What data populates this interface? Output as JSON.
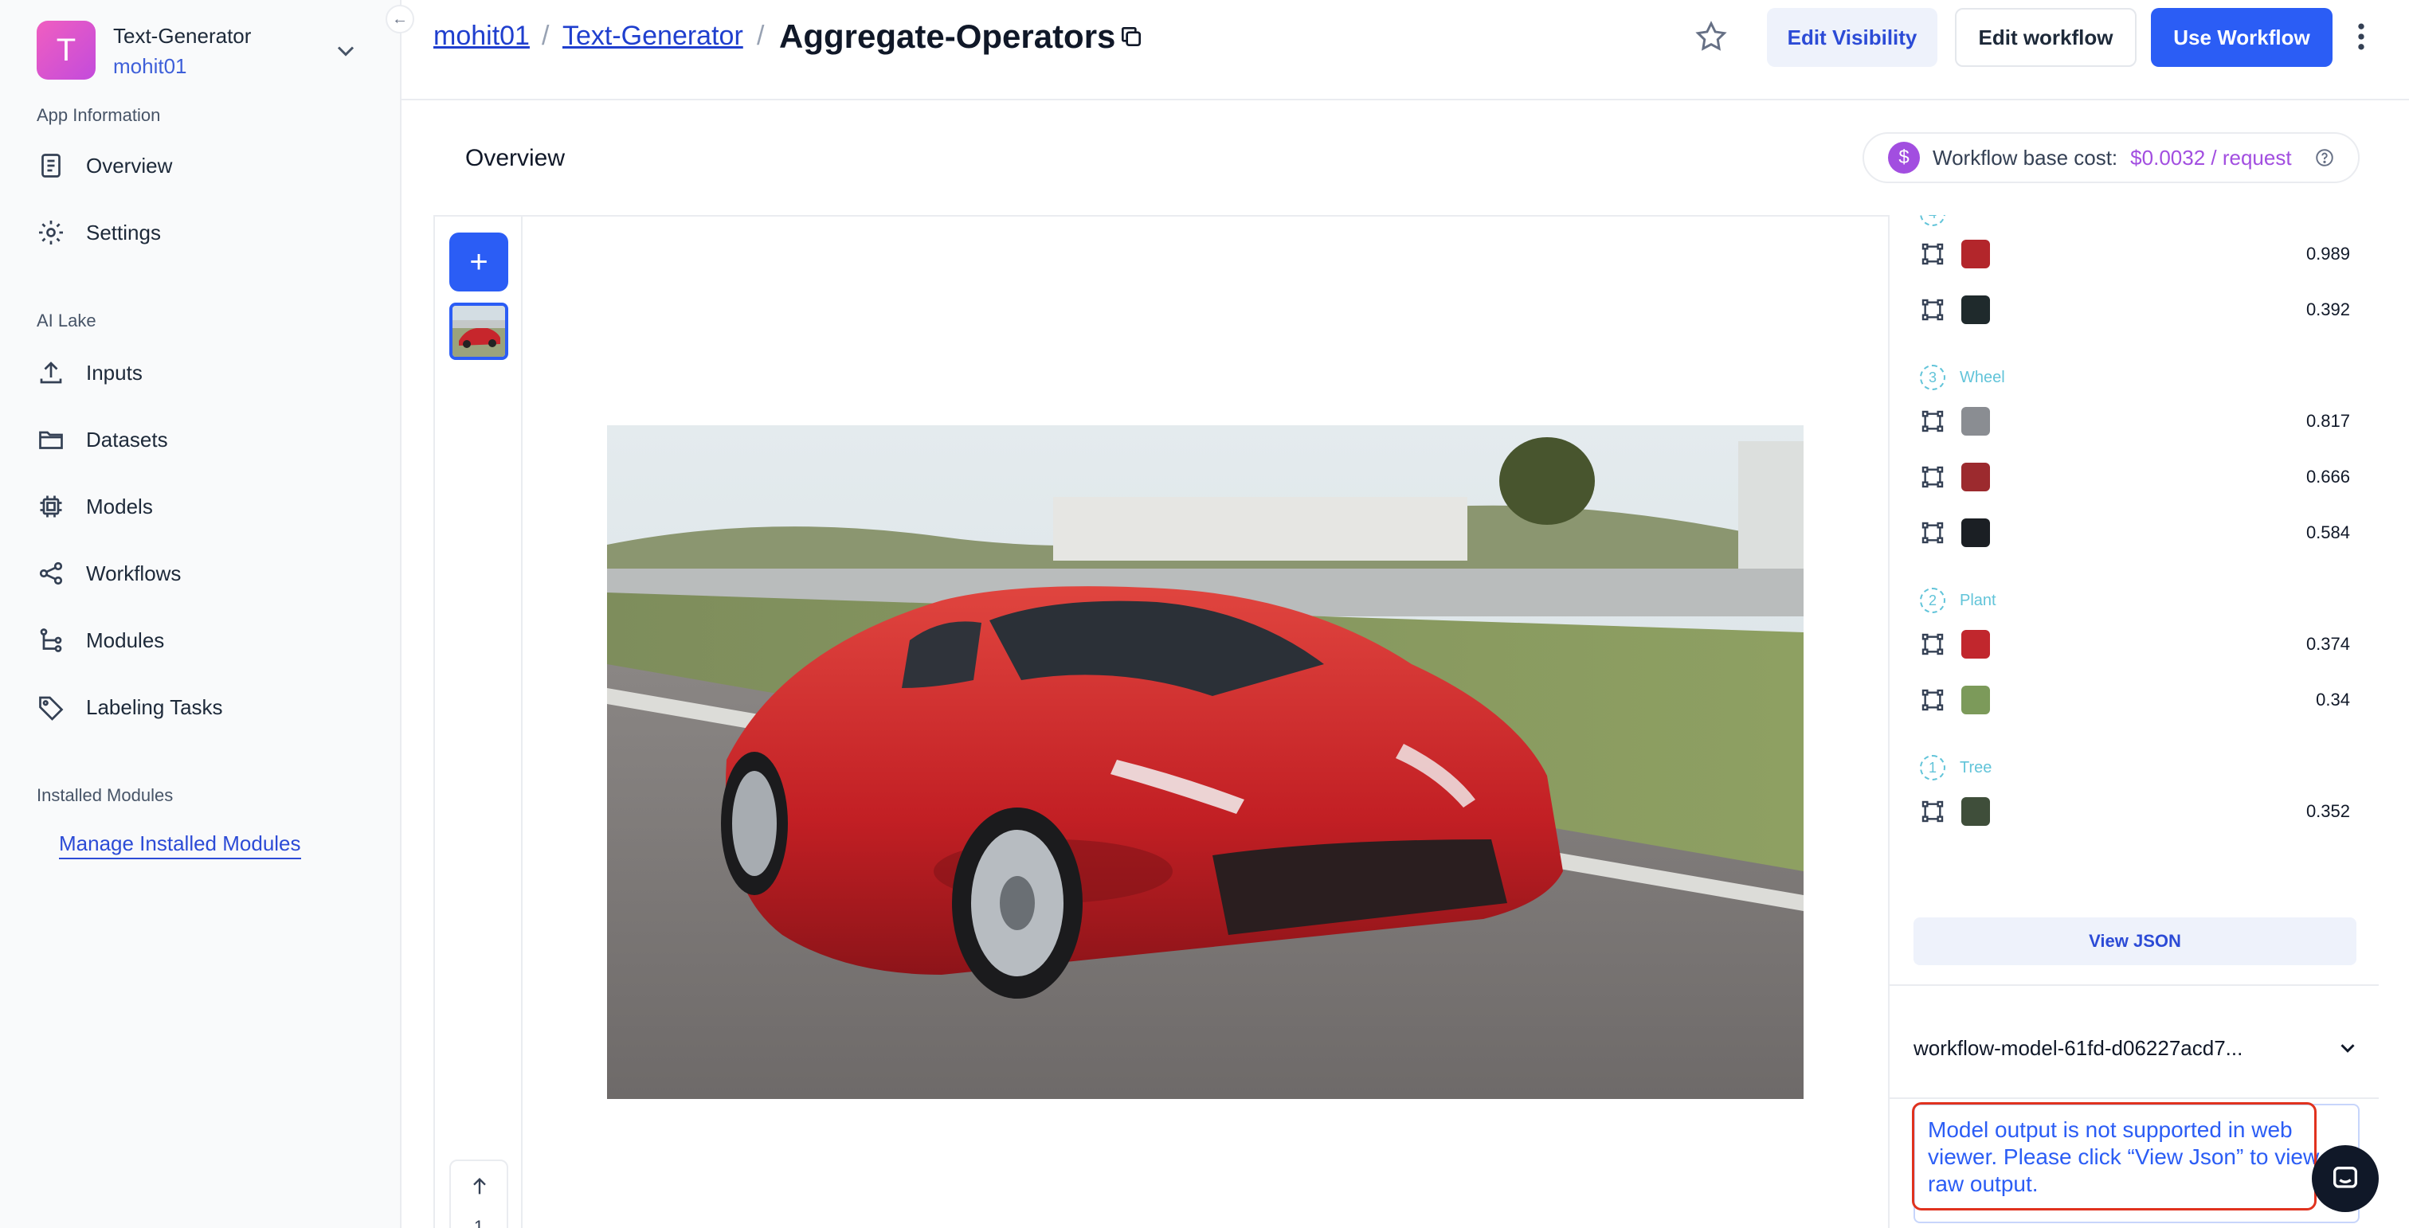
{
  "sidebar": {
    "app_initial": "T",
    "app_name": "Text-Generator",
    "app_owner": "mohit01",
    "sections": {
      "app_information": "App Information",
      "ai_lake": "AI Lake",
      "installed_modules": "Installed Modules"
    },
    "items": [
      {
        "label": "Overview",
        "icon": "document-icon"
      },
      {
        "label": "Settings",
        "icon": "gear-icon"
      },
      {
        "label": "Inputs",
        "icon": "upload-icon"
      },
      {
        "label": "Datasets",
        "icon": "folder-icon"
      },
      {
        "label": "Models",
        "icon": "chip-icon"
      },
      {
        "label": "Workflows",
        "icon": "share-nodes-icon"
      },
      {
        "label": "Modules",
        "icon": "tree-icon"
      },
      {
        "label": "Labeling Tasks",
        "icon": "tag-icon"
      }
    ],
    "manage_link": "Manage Installed Modules"
  },
  "header": {
    "breadcrumb": [
      "mohit01",
      "Text-Generator"
    ],
    "separator": "/",
    "title": "Aggregate-Operators",
    "buttons": {
      "edit_visibility": "Edit Visibility",
      "edit_workflow": "Edit workflow",
      "use_workflow": "Use Workflow"
    }
  },
  "overview": {
    "title": "Overview",
    "cost_label": "Workflow base cost:",
    "cost_value": "$0.0032 / request",
    "cost_icon": "$"
  },
  "viewer": {
    "add_label": "+",
    "page_number": "1"
  },
  "results": {
    "top_rows": [
      {
        "score": "0.989",
        "crop_color": "#b3262b"
      },
      {
        "score": "0.392",
        "crop_color": "#1f2a2c"
      }
    ],
    "groups": [
      {
        "num": "3",
        "name": "Wheel",
        "rows": [
          {
            "score": "0.817",
            "crop_color": "#8a8d92"
          },
          {
            "score": "0.666",
            "crop_color": "#9c2a2e"
          },
          {
            "score": "0.584",
            "crop_color": "#1b1f24"
          }
        ]
      },
      {
        "num": "2",
        "name": "Plant",
        "rows": [
          {
            "score": "0.374",
            "crop_color": "#c1272d"
          },
          {
            "score": "0.34",
            "crop_color": "#7c9a5a"
          }
        ]
      },
      {
        "num": "1",
        "name": "Tree",
        "rows": [
          {
            "score": "0.352",
            "crop_color": "#3f4e3a"
          }
        ]
      }
    ],
    "view_json": "View JSON",
    "model_name": "workflow-model-61fd-d06227acd7...",
    "unsupported_msg": "Model output is not supported in web viewer. Please click “View Json” to view raw output."
  },
  "colors": {
    "primary": "#2b5df5",
    "cost_accent": "#a24ee0",
    "concept": "#62c4d9",
    "highlight": "#e0321e"
  }
}
